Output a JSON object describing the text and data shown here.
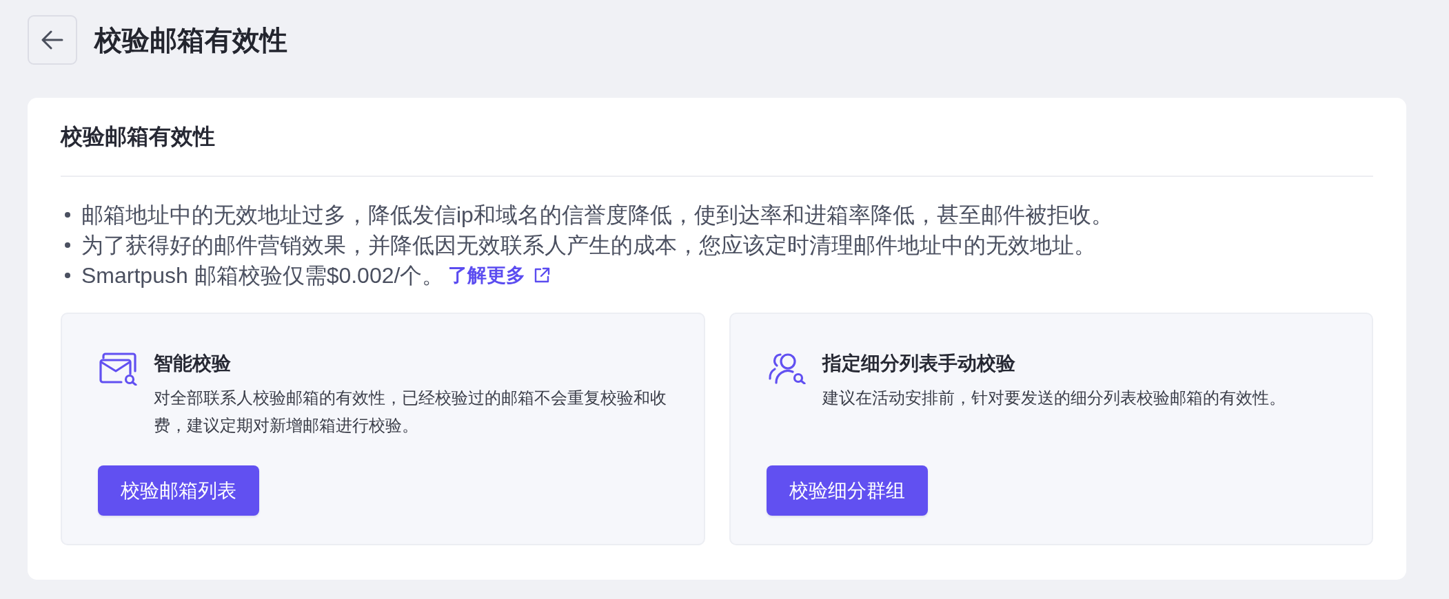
{
  "header": {
    "title": "校验邮箱有效性"
  },
  "panel": {
    "title": "校验邮箱有效性",
    "bullets": [
      {
        "text": "邮箱地址中的无效地址过多，降低发信ip和域名的信誉度降低，使到达率和进箱率降低，甚至邮件被拒收。"
      },
      {
        "text": "为了获得好的邮件营销效果，并降低因无效联系人产生的成本，您应该定时清理邮件地址中的无效地址。"
      },
      {
        "text": "Smartpush 邮箱校验仅需$0.002/个。",
        "link": "了解更多"
      }
    ],
    "options": [
      {
        "kind": "mailbox",
        "title": "智能校验",
        "description": "对全部联系人校验邮箱的有效性，已经校验过的邮箱不会重复校验和收费，建议定期对新增邮箱进行校验。",
        "button": "校验邮箱列表"
      },
      {
        "kind": "segment",
        "title": "指定细分列表手动校验",
        "description": "建议在活动安排前，针对要发送的细分列表校验邮箱的有效性。",
        "button": "校验细分群组"
      }
    ]
  }
}
